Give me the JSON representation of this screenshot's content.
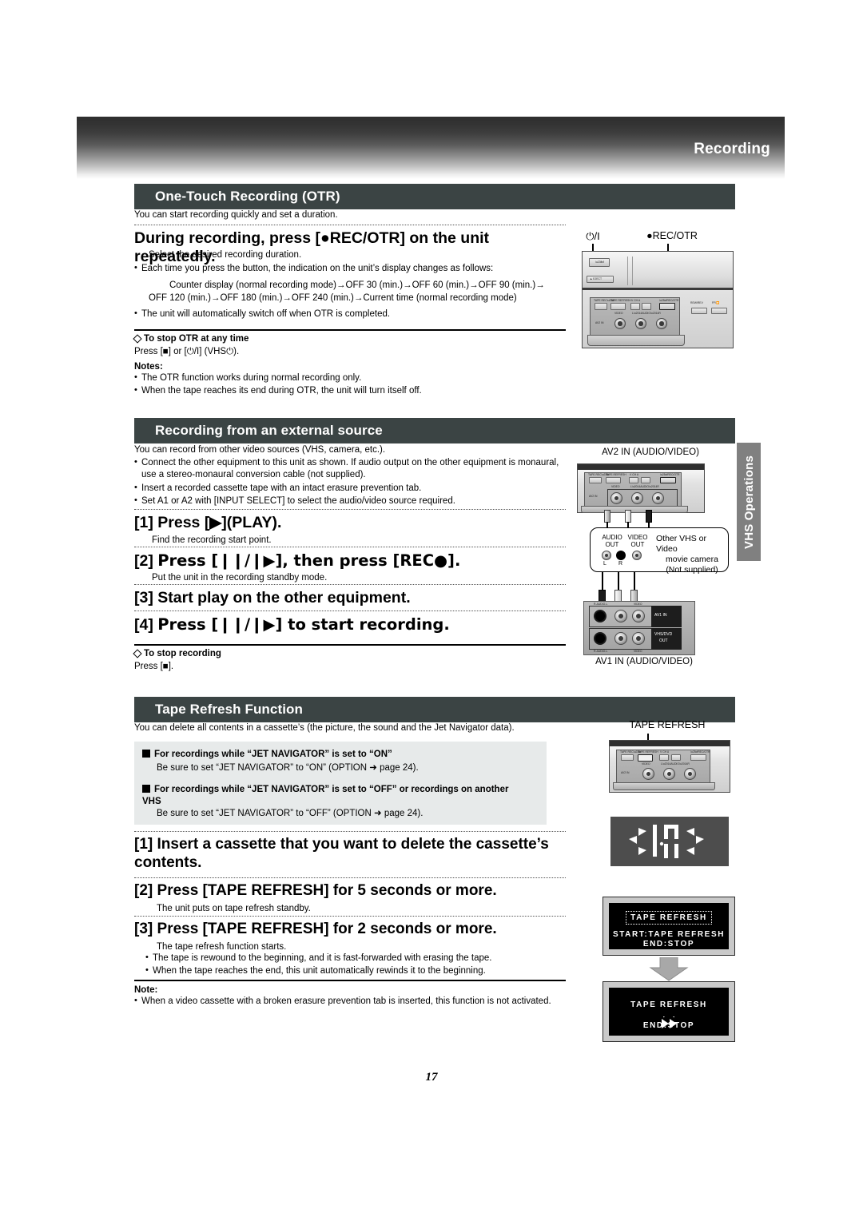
{
  "header": {
    "title": "Recording"
  },
  "side_tab": {
    "label": "VHS Operations"
  },
  "page_number": "17",
  "sections": {
    "otr": {
      "bar_title": "One-Touch Recording (OTR)",
      "intro": "You can start recording quickly and set a duration.",
      "step_heading": "During recording, press [●REC/OTR] on the unit repeatedly.",
      "step_sub": "Select the desired recording duration.",
      "bullet1": "Each time you press the button, the indication on the unit’s display changes as follows:",
      "sequence_line1": "Counter display (normal recording mode)→OFF 30 (min.)→OFF 60 (min.)→OFF 90 (min.)→",
      "sequence_line2": "OFF 120 (min.)→OFF 180 (min.)→OFF 240 (min.)→Current time (normal recording mode)",
      "bullet2": "The unit will automatically switch off when OTR is completed.",
      "stop_heading": "To stop OTR at any time",
      "stop_text": "Press [■] or [⏻/I] (VHS⏻).",
      "notes_heading": "Notes:",
      "notes": [
        "The OTR function works during normal recording only.",
        "When the tape reaches its end during OTR, the unit will turn itself off."
      ],
      "illustration": {
        "label_power": "⏻/I",
        "label_rec": "●REC/OTR",
        "panel_buttons": [
          "TAPE REC⏻",
          "TAPE REFRESH",
          "V",
          "CH",
          "A",
          "●REC/OTR"
        ],
        "panel_sublabels": [
          "VIDEO",
          "L— AUDIO —R"
        ],
        "av2_in_label": "AV2 IN",
        "eject_label": "▲ EJECT",
        "rew_label": "REW/REV",
        "ff_label": "FF/⏩"
      }
    },
    "external": {
      "bar_title": "Recording from an external source",
      "intro": "You can record from other video sources (VHS, camera, etc.).",
      "bullets": [
        "Connect the other equipment to this unit as shown. If audio output on the other equipment is monaural, use a stereo-monaural conversion cable (not supplied).",
        "Insert a recorded cassette tape with an intact erasure prevention tab.",
        "Set A1 or A2 with [INPUT SELECT] to select the audio/video source required."
      ],
      "steps": [
        {
          "num": "[1]",
          "text": "Press [▶](PLAY).",
          "sub": "Find the recording start point."
        },
        {
          "num": "[2]",
          "text": "Press [❙❙/❙▶], then press [REC●].",
          "sub": "Put the unit in the recording standby mode."
        },
        {
          "num": "[3]",
          "text": "Start play on the other equipment.",
          "sub": ""
        },
        {
          "num": "[4]",
          "text": "Press [❙❙/❙▶] to start recording.",
          "sub": ""
        }
      ],
      "stop_heading": "To stop recording",
      "stop_text": "Press [■].",
      "illustration": {
        "av2_caption": "AV2 IN (AUDIO/VIDEO)",
        "av1_caption": "AV1 IN (AUDIO/VIDEO)",
        "device_labels": [
          "AUDIO",
          "VIDEO",
          "OUT",
          "OUT",
          "L",
          "R"
        ],
        "device_text_line1": "Other VHS or Video",
        "device_text_line2": "movie camera",
        "device_text_line3": "(Not supplied)",
        "rear_labels": [
          "R-AUDIO-L",
          "VIDEO",
          "AV1 IN",
          "VHS/DVD",
          "OUT"
        ]
      }
    },
    "tape_refresh": {
      "bar_title": "Tape Refresh Function",
      "intro": "You can delete all contents in a cassette’s (the picture, the sound and the Jet Navigator data).",
      "box": [
        {
          "heading": "For recordings while “JET NAVIGATOR” is set to “ON”",
          "body": "Be sure to set “JET NAVIGATOR” to “ON” (OPTION ➜ page 24)."
        },
        {
          "heading": "For recordings while “JET NAVIGATOR” is set to “OFF” or recordings on another VHS",
          "body": "Be sure to set “JET NAVIGATOR” to “OFF” (OPTION ➜ page 24)."
        }
      ],
      "steps": [
        {
          "num": "[1]",
          "text": "Insert a cassette that you want to delete the cassette’s contents.",
          "sub": ""
        },
        {
          "num": "[2]",
          "text": "Press [TAPE REFRESH] for 5 seconds or more.",
          "sub": "The unit puts on tape refresh standby."
        },
        {
          "num": "[3]",
          "text": "Press [TAPE REFRESH] for 2 seconds or more.",
          "sub": "The tape refresh function starts."
        }
      ],
      "step3_bullets": [
        "The tape is rewound to the beginning, and it is fast-forwarded with erasing the tape.",
        "When the tape reaches the end, this unit automatically rewinds it to the beginning."
      ],
      "note_heading": "Note:",
      "note_text": "When a video cassette with a broken erasure prevention tab is inserted, this function is not activated.",
      "illustration": {
        "caption": "TAPE REFRESH",
        "osd1_title": "TAPE REFRESH",
        "osd1_line1": "START:TAPE REFRESH",
        "osd1_line2": "END:STOP",
        "osd2_title": "TAPE REFRESH",
        "osd2_line1": "END:STOP"
      }
    }
  },
  "colors": {
    "section_bar": "#3b4444",
    "side_tab": "#808080",
    "gray_block": "#e7eaea"
  }
}
